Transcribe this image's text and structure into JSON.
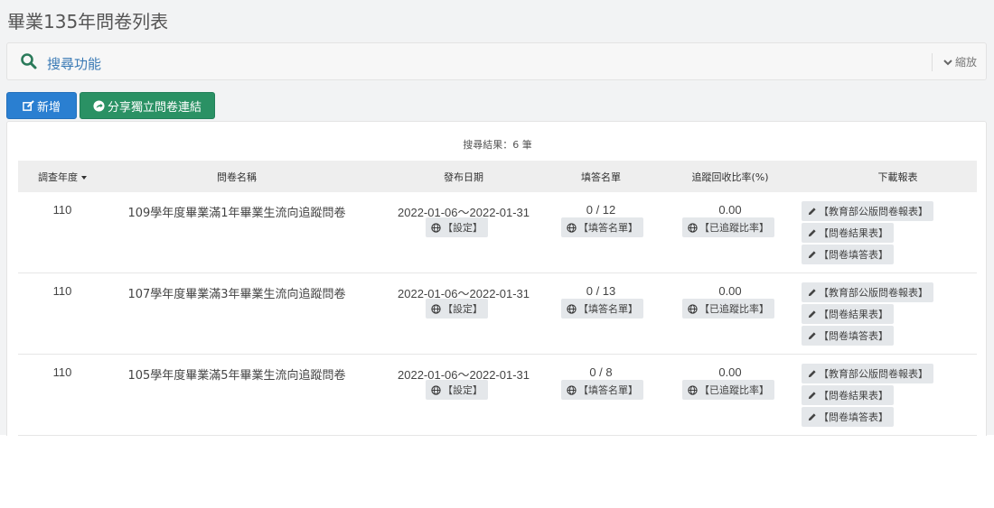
{
  "page": {
    "title": "畢業135年問卷列表"
  },
  "search": {
    "title": "搜尋功能",
    "collapse_label": "縮放"
  },
  "toolbar": {
    "add_label": "新增",
    "share_label": "分享獨立問卷連結"
  },
  "results": {
    "count_text": "搜尋結果：6 筆"
  },
  "table": {
    "headers": {
      "year": "調查年度",
      "name": "問卷名稱",
      "date": "發布日期",
      "list": "填答名單",
      "rate": "追蹤回收比率(%)",
      "download": "下載報表"
    },
    "sort_column": "year",
    "rows": [
      {
        "year": "110",
        "name": "109學年度畢業滿1年畢業生流向追蹤問卷",
        "date": "2022-01-06～2022-01-31",
        "setting_label": "【設定】",
        "count": "0 / 12",
        "list_label": "【填答名單】",
        "rate": "0.00",
        "rate_label": "【已追蹤比率】",
        "dl_ministry": "【教育部公版問卷報表】",
        "dl_result": "【問卷結果表】",
        "dl_fill": "【問卷填答表】"
      },
      {
        "year": "110",
        "name": "107學年度畢業滿3年畢業生流向追蹤問卷",
        "date": "2022-01-06～2022-01-31",
        "setting_label": "【設定】",
        "count": "0 / 13",
        "list_label": "【填答名單】",
        "rate": "0.00",
        "rate_label": "【已追蹤比率】",
        "dl_ministry": "【教育部公版問卷報表】",
        "dl_result": "【問卷結果表】",
        "dl_fill": "【問卷填答表】"
      },
      {
        "year": "110",
        "name": "105學年度畢業滿5年畢業生流向追蹤問卷",
        "date": "2022-01-06～2022-01-31",
        "setting_label": "【設定】",
        "count": "0 / 8",
        "list_label": "【填答名單】",
        "rate": "0.00",
        "rate_label": "【已追蹤比率】",
        "dl_ministry": "【教育部公版問卷報表】",
        "dl_result": "【問卷結果表】",
        "dl_fill": "【問卷填答表】"
      }
    ]
  },
  "icons": {
    "search": "search-icon",
    "collapse": "chevron-down-icon",
    "add": "edit-icon",
    "share": "share-icon",
    "globe": "globe-icon",
    "pencil": "pencil-icon"
  },
  "colors": {
    "primary": "#2a7fd1",
    "success": "#2a9164",
    "search_title": "#3a7ab5",
    "chip_bg": "#e4e7ea"
  }
}
